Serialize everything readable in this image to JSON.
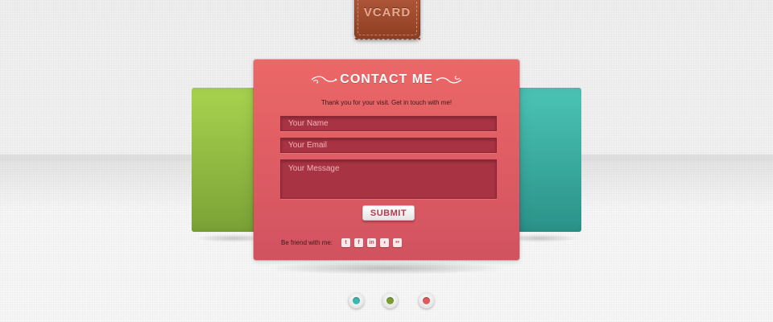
{
  "header": {
    "tag_label": "VCARD"
  },
  "colors": {
    "leather": "#9c4a2d",
    "card_green": "#93c046",
    "card_pink": "#e05e63",
    "card_teal": "#3bb0a3",
    "field_bg": "#a83342",
    "button_text": "#b8384a"
  },
  "contact": {
    "title": "CONTACT ME",
    "intro": "Thank you for your visit. Get in touch with me!",
    "name_placeholder": "Your Name",
    "email_placeholder": "Your Email",
    "message_placeholder": "Your Message",
    "submit_label": "SUBMIT",
    "friend_label": "Be friend with me:",
    "social": [
      {
        "icon": "twitter-icon",
        "glyph": "t"
      },
      {
        "icon": "facebook-icon",
        "glyph": "f"
      },
      {
        "icon": "linkedin-icon",
        "glyph": "in"
      },
      {
        "icon": "lastfm-icon",
        "glyph": "◖"
      },
      {
        "icon": "flickr-icon",
        "glyph": "••"
      }
    ]
  },
  "pagination": {
    "dots": [
      {
        "color": "#3bb8b0"
      },
      {
        "color": "#7a9f2e"
      },
      {
        "color": "#e05a5e"
      }
    ]
  }
}
